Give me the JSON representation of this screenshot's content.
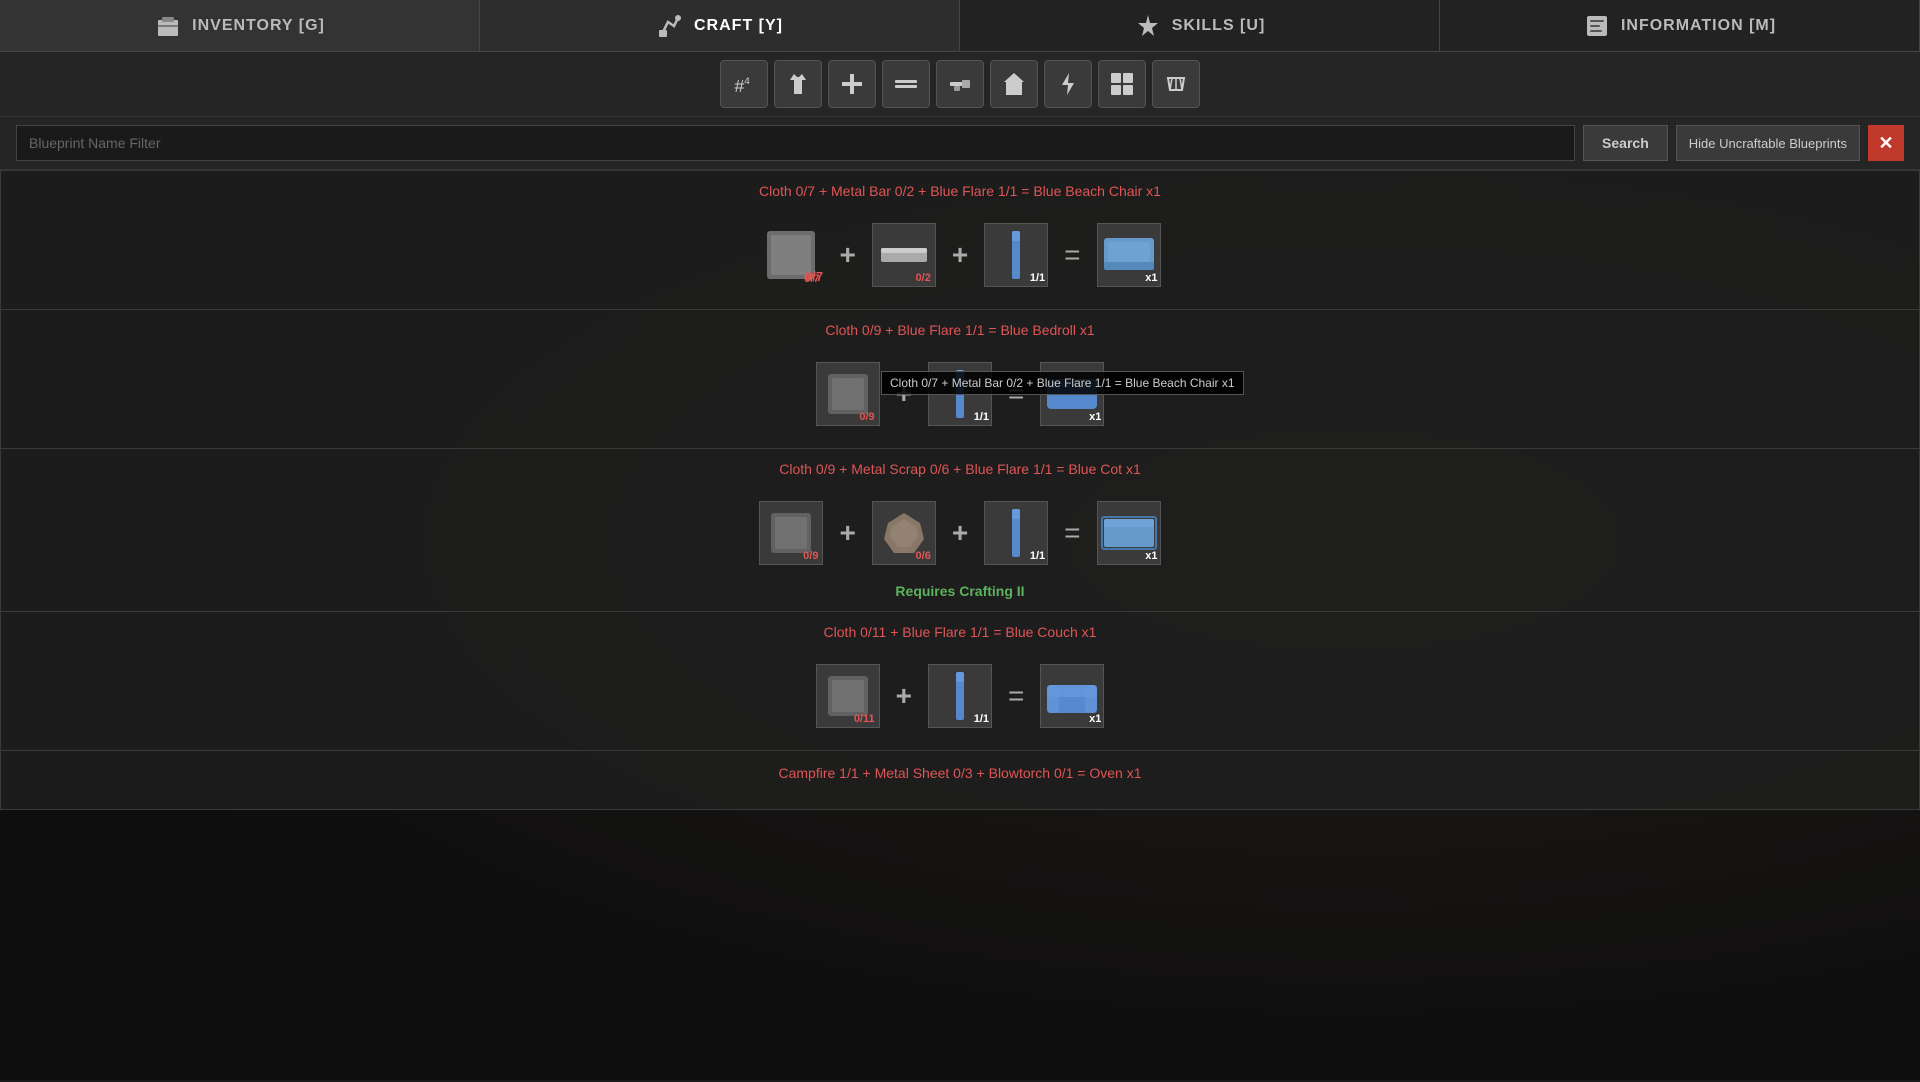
{
  "nav": {
    "items": [
      {
        "id": "inventory",
        "label": "Inventory [G]",
        "icon": "🔫",
        "active": false
      },
      {
        "id": "craft",
        "label": "Craft [Y]",
        "icon": "🔧",
        "active": true
      },
      {
        "id": "skills",
        "label": "Skills [U]",
        "icon": "⬆",
        "active": false
      },
      {
        "id": "information",
        "label": "Information [M]",
        "icon": "📋",
        "active": false
      }
    ]
  },
  "toolbar": {
    "buttons": [
      {
        "id": "all",
        "icon": "#",
        "label": "All"
      },
      {
        "id": "clothing",
        "icon": "👕",
        "label": "Clothing"
      },
      {
        "id": "medical",
        "icon": "+",
        "label": "Medical"
      },
      {
        "id": "tools",
        "icon": "🔨",
        "label": "Tools"
      },
      {
        "id": "weapons",
        "icon": "≡",
        "label": "Weapons"
      },
      {
        "id": "building",
        "icon": "🏠",
        "label": "Building"
      },
      {
        "id": "electrical",
        "icon": "⚡",
        "label": "Electrical"
      },
      {
        "id": "misc",
        "icon": "⊞",
        "label": "Misc"
      },
      {
        "id": "workbench",
        "icon": "✂",
        "label": "Workbench"
      }
    ]
  },
  "search": {
    "placeholder": "Blueprint Name Filter",
    "button_label": "Search",
    "hide_button_label": "Hide Uncraftable Blueprints"
  },
  "blueprints": [
    {
      "id": "blue-beach-chair",
      "title": "Cloth 0/7 + Metal Bar 0/2 + Blue Flare 1/1 = Blue Beach Chair x1",
      "craftable": false,
      "has_tooltip": true,
      "tooltip": "Cloth 0/7 + Metal Bar 0/2 + Blue Flare 1/1 = Blue Beach Chair x1",
      "ingredients": [
        {
          "id": "cloth",
          "type": "cloth",
          "count": "0/7",
          "sufficient": false
        },
        {
          "id": "metal-bar",
          "type": "metal-bar",
          "count": "0/2",
          "sufficient": false
        },
        {
          "id": "blue-flare",
          "type": "blue-flare",
          "count": "1/1",
          "sufficient": true
        }
      ],
      "result": {
        "id": "beach-chair",
        "type": "beach-chair",
        "count": "x1"
      }
    },
    {
      "id": "blue-bedroll",
      "title": "Cloth 0/9 + Blue Flare 1/1 = Blue Bedroll x1",
      "craftable": false,
      "has_tooltip": false,
      "ingredients": [
        {
          "id": "cloth",
          "type": "cloth",
          "count": "0/9",
          "sufficient": false
        },
        {
          "id": "blue-flare",
          "type": "blue-flare",
          "count": "1/1",
          "sufficient": true
        }
      ],
      "result": {
        "id": "bedroll",
        "type": "bedroll",
        "count": "x1"
      }
    },
    {
      "id": "blue-cot",
      "title": "Cloth 0/9 + Metal Scrap 0/6 + Blue Flare 1/1 = Blue Cot x1",
      "craftable": false,
      "requires_crafting": "Requires Crafting II",
      "ingredients": [
        {
          "id": "cloth",
          "type": "cloth",
          "count": "0/9",
          "sufficient": false
        },
        {
          "id": "metal-scrap",
          "type": "metal-scrap",
          "count": "0/6",
          "sufficient": false
        },
        {
          "id": "blue-flare",
          "type": "blue-flare",
          "count": "1/1",
          "sufficient": true
        }
      ],
      "result": {
        "id": "cot",
        "type": "cot",
        "count": "x1"
      }
    },
    {
      "id": "blue-couch",
      "title": "Cloth 0/11 + Blue Flare 1/1 = Blue Couch x1",
      "craftable": false,
      "ingredients": [
        {
          "id": "cloth",
          "type": "cloth",
          "count": "0/11",
          "sufficient": false
        },
        {
          "id": "blue-flare",
          "type": "blue-flare",
          "count": "1/1",
          "sufficient": true
        }
      ],
      "result": {
        "id": "couch",
        "type": "couch",
        "count": "x1"
      }
    },
    {
      "id": "oven",
      "title": "Campfire 1/1 + Metal Sheet 0/3 + Blowtorch 0/1 = Oven x1",
      "craftable": false,
      "partial": true,
      "ingredients": [],
      "result": {}
    }
  ]
}
